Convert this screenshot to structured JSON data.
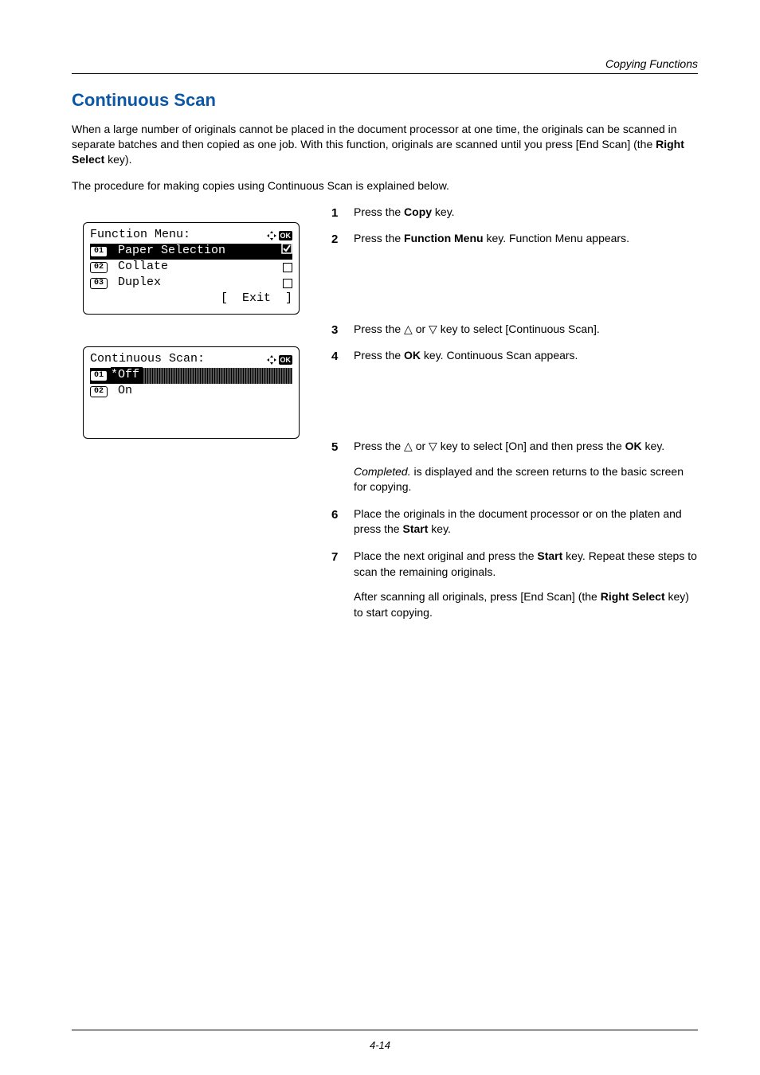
{
  "runningHead": "Copying Functions",
  "title": "Continuous Scan",
  "intro": [
    "When a large number of originals cannot be placed in the document processor at one time, the originals can be scanned in separate batches and then copied as one job. With this function, originals are scanned until you press [End Scan] (the Right Select key).",
    "The procedure for making copies using Continuous Scan is explained below."
  ],
  "introBoldSpan": "Right Select",
  "lcd1": {
    "title": "Function Menu:",
    "rows": [
      {
        "num": "01",
        "label": " Paper Selection",
        "mark": "check",
        "selected": true
      },
      {
        "num": "02",
        "label": " Collate",
        "mark": "box",
        "selected": false
      },
      {
        "num": "03",
        "label": " Duplex",
        "mark": "box",
        "selected": false
      }
    ],
    "footer": "[  Exit  ]"
  },
  "lcd2": {
    "title": "Continuous Scan:",
    "rows": [
      {
        "num": "01",
        "label": "*Off",
        "selected": true
      },
      {
        "num": "02",
        "label": " On",
        "selected": false
      }
    ]
  },
  "steps": [
    {
      "text": "Press the Copy key.",
      "bold": [
        "Copy"
      ]
    },
    {
      "text": "Press the Function Menu key. Function Menu appears.",
      "bold": [
        "Function Menu"
      ]
    },
    {
      "text": "Press the △ or ▽ key to select [Continuous Scan]."
    },
    {
      "text": "Press the OK key. Continuous Scan appears.",
      "bold": [
        "OK"
      ]
    },
    {
      "text": "Press the △ or ▽ key to select [On] and then press the OK key.",
      "bold": [
        "OK"
      ],
      "sub": {
        "text": "Completed. is displayed and the screen returns to the basic screen for copying.",
        "italic": [
          "Completed."
        ]
      }
    },
    {
      "text": "Place the originals in the document processor or on the platen and press the Start key.",
      "bold": [
        "Start"
      ]
    },
    {
      "text": "Place the next original and press the Start key. Repeat these steps to scan the remaining originals.",
      "bold": [
        "Start"
      ],
      "sub": {
        "text": "After scanning all originals, press [End Scan] (the Right Select key) to start copying.",
        "bold": [
          "Right Select"
        ]
      }
    }
  ],
  "pageNumber": "4-14"
}
